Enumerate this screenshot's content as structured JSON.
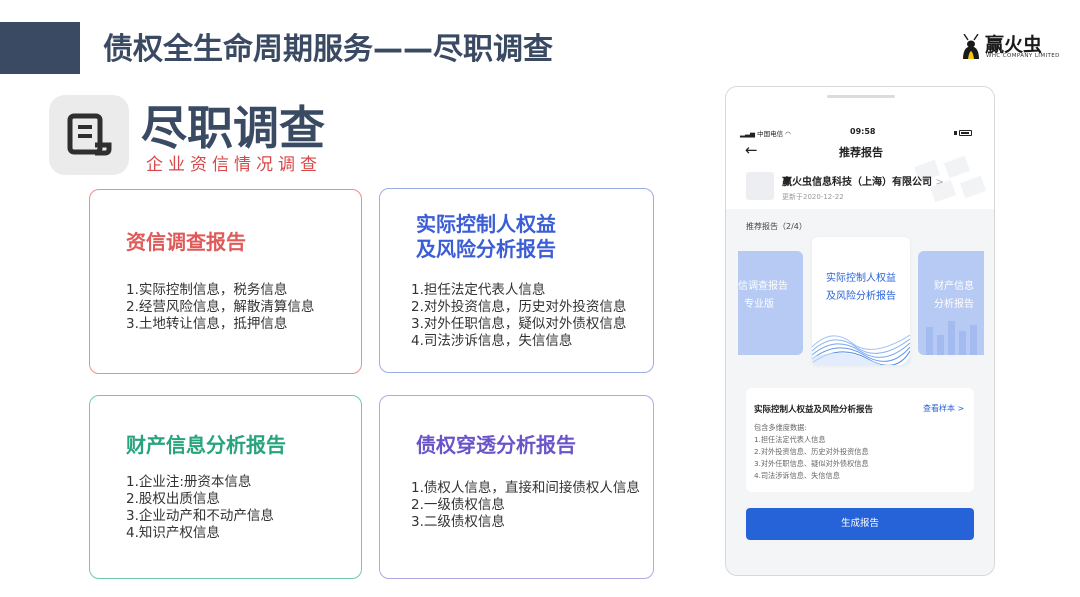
{
  "slide": {
    "title": "债权全生命周期服务——尽职调查"
  },
  "logo": {
    "name_cn": "赢火虫",
    "name_en": "WHC COMPANY LIMITED"
  },
  "section": {
    "title": "尽职调查",
    "subtitle": "企业资信情况调查",
    "icon": "scroll-document-icon"
  },
  "cards": [
    {
      "title_lines": [
        "资信调查报告"
      ],
      "color": "#e05a5a",
      "items": [
        "1.实际控制信息，税务信息",
        "2.经营风险信息，解散清算信息",
        "3.土地转让信息，抵押信息"
      ]
    },
    {
      "title_lines": [
        "实际控制人权益",
        "及风险分析报告"
      ],
      "color": "#3b5dd6",
      "items": [
        "1.担任法定代表人信息",
        "2.对外投资信息，历史对外投资信息",
        "3.对外任职信息，疑似对外债权信息",
        "4.司法涉诉信息，失信信息"
      ]
    },
    {
      "title_lines": [
        "财产信息分析报告"
      ],
      "color": "#27a37e",
      "items": [
        "1.企业注:册资本信息",
        "2.股权出质信息",
        "3.企业动产和不动产信息",
        "4.知识产权信息"
      ]
    },
    {
      "title_lines": [
        "债权穿透分析报告"
      ],
      "color": "#6a54c8",
      "items": [
        "1.债权人信息，直接和间接债权人信息",
        "2.一级债权信息",
        "3.二级债权信息"
      ]
    }
  ],
  "phone": {
    "status": {
      "carrier": "中国电信",
      "time": "09:58"
    },
    "nav": {
      "back_glyph": "←",
      "title": "推荐报告"
    },
    "company": {
      "name": "赢火虫信息科技（上海）有限公司",
      "updated": "更新于2020-12-22"
    },
    "recommend_label": "推荐报告（2/4）",
    "carousel": {
      "left_lines": [
        "信调查报告",
        "专业版"
      ],
      "center_lines": [
        "实际控制人权益",
        "及风险分析报告"
      ],
      "right_lines": [
        "财产信息",
        "分析报告"
      ]
    },
    "detail": {
      "title": "实际控制人权益及风险分析报告",
      "link": "查看样本 >",
      "lines": [
        "包含多维度数据:",
        "1.担任法定代表人信息",
        "2.对外投资信息、历史对外投资信息",
        "3.对外任职信息、疑似对外债权信息",
        "4.司法涉诉信息、失信信息"
      ]
    },
    "button_label": "生成报告",
    "accent_color": "#2663d8"
  }
}
